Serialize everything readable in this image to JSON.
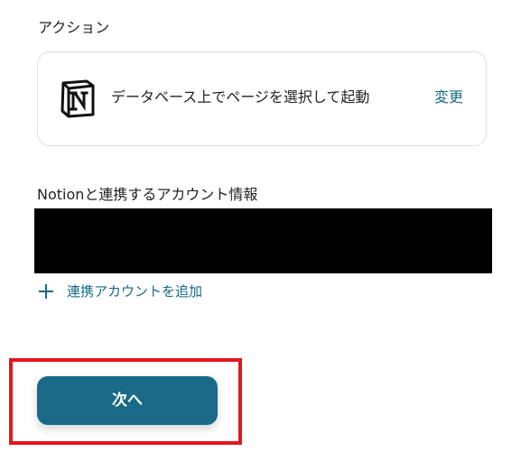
{
  "action_section": {
    "label": "アクション"
  },
  "action_card": {
    "icon": "notion-logo-icon",
    "text": "データベース上でページを選択して起動",
    "change_label": "変更"
  },
  "account_section": {
    "label": "Notionと連携するアカウント情報",
    "add_account_label": "連携アカウントを追加"
  },
  "footer": {
    "next_label": "次へ"
  },
  "colors": {
    "accent": "#186a86",
    "highlight": "#e3161c",
    "redacted": "#000000",
    "border": "#d9dde1"
  }
}
